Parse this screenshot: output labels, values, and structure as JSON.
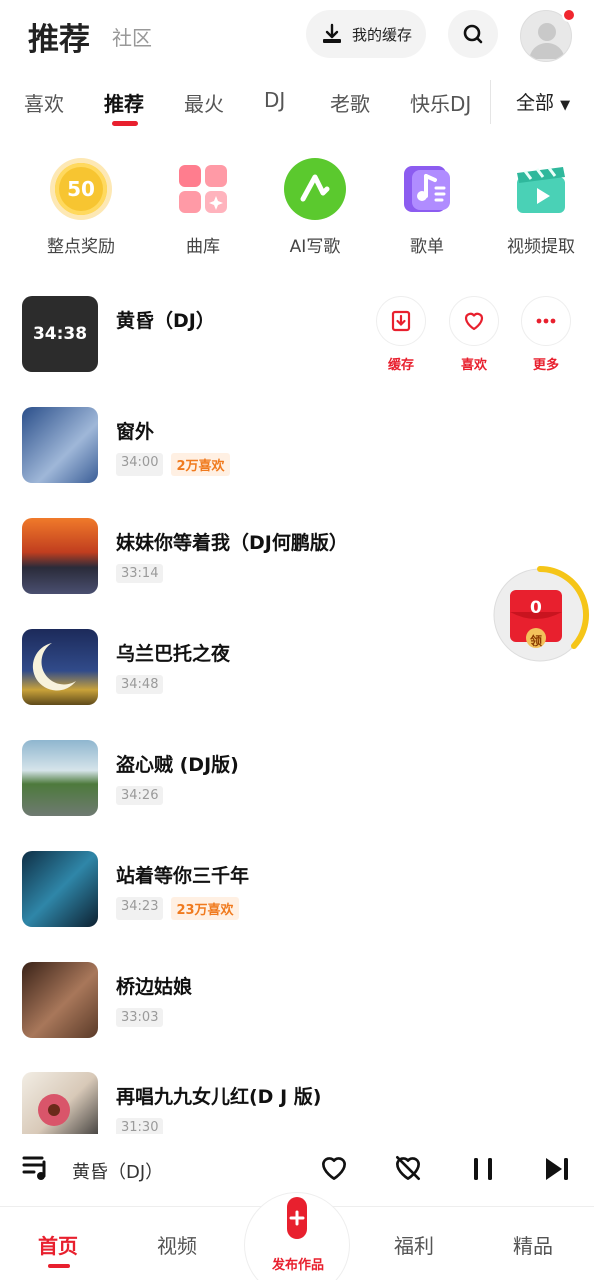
{
  "header": {
    "title": "推荐",
    "subtitle": "社区",
    "cache_label": "我的缓存"
  },
  "tabs": [
    "喜欢",
    "推荐",
    "最火",
    "DJ",
    "老歌",
    "快乐DJ"
  ],
  "tab_all": "全部",
  "quick_entries": [
    {
      "label": "整点奖励",
      "badge": "50"
    },
    {
      "label": "曲库"
    },
    {
      "label": "AI写歌"
    },
    {
      "label": "歌单"
    },
    {
      "label": "视频提取"
    }
  ],
  "songs": [
    {
      "title": "黄昏（DJ）",
      "cover_text": "34:38"
    },
    {
      "title": "窗外",
      "duration": "34:00",
      "likes": "2万喜欢"
    },
    {
      "title": "妹妹你等着我（DJ何鹏版）",
      "duration": "33:14"
    },
    {
      "title": "乌兰巴托之夜",
      "duration": "34:48"
    },
    {
      "title": "盗心贼 (DJ版)",
      "duration": "34:26"
    },
    {
      "title": "站着等你三千年",
      "duration": "34:23",
      "likes": "23万喜欢"
    },
    {
      "title": "桥边姑娘",
      "duration": "33:03"
    },
    {
      "title": "再唱九九女儿红(D J 版)",
      "duration": "31:30"
    }
  ],
  "actions": {
    "cache": "缓存",
    "like": "喜欢",
    "more": "更多"
  },
  "red_packet": {
    "count": "0",
    "claim": "领"
  },
  "player": {
    "title": "黄昏（DJ）"
  },
  "nav": {
    "home": "首页",
    "video": "视频",
    "publish": "发布作品",
    "welfare": "福利",
    "premium": "精品"
  },
  "colors": {
    "accent": "#e8202e",
    "like_tag": "#f07a1e"
  }
}
